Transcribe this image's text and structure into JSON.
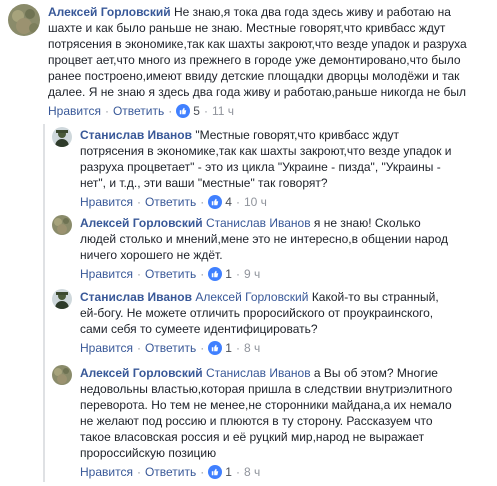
{
  "comments": [
    {
      "author": "Алексей Горловский",
      "lines": [
        "Не знаю,я тока два года здесь живу и работаю на",
        "шахте и как было раньше не знаю. Местные говорят,что кривбасс ждут",
        "потрясения в экономике,так как шахты закроют,что везде упадок и разруха",
        "процвет ает,что много из прежнего в городе уже демонтировано,что было",
        "ранее построено,имеют ввиду детские площадки дворцы молодёжи и так",
        "далее. Я не знаю я здесь два года живу и работаю,раньше никогда не был"
      ],
      "like": "Нравится",
      "reply": "Ответить",
      "reactions": "5",
      "time": "11 ч"
    },
    {
      "author": "Станислав Иванов",
      "lines": [
        "\"Местные говорят,что кривбасс ждут",
        "потрясения в экономике,так как шахты закроют,что везде упадок и",
        "разруха процветает\" - это из цикла \"Украине - пизда\", \"Украины -",
        "нет\", и т.д., эти ваши \"местные\" так говорят?"
      ],
      "like": "Нравится",
      "reply": "Ответить",
      "reactions": "4",
      "time": "10 ч"
    },
    {
      "author": "Алексей Горловский",
      "mention": "Станислав Иванов",
      "lines": [
        "я не знаю! Сколько",
        "людей столько и мнений,мене это не интересно,в общении народ",
        "ничего хорошего не ждёт."
      ],
      "like": "Нравится",
      "reply": "Ответить",
      "reactions": "1",
      "time": "9 ч"
    },
    {
      "author": "Станислав Иванов",
      "mention": "Алексей Горловский",
      "lines": [
        "Какой-то вы странный,",
        "ей-богу. Не можете отличить проросийского от проукраинского,",
        "сами себя то сумеете идентифицировать?"
      ],
      "like": "Нравится",
      "reply": "Ответить",
      "reactions": "1",
      "time": "8 ч"
    },
    {
      "author": "Алексей Горловский",
      "mention": "Станислав Иванов",
      "lines": [
        "а Вы об этом? Многие",
        "недовольны властью,которая пришла в следствии внутриэлитного",
        "переворота. Но тем не менее,не сторонники майдана,а их немало",
        "не желают под россию и плюются в ту сторону. Рассказуем что",
        "такое власовская россия и её руцкий мир,народ не выражает",
        "пророссийскую позицию"
      ],
      "like": "Нравится",
      "reply": "Ответить",
      "reactions": "1",
      "time": "8 ч"
    }
  ],
  "colors": {
    "link": "#385898",
    "meta": "#90949c",
    "like_badge": "#4080ff"
  }
}
